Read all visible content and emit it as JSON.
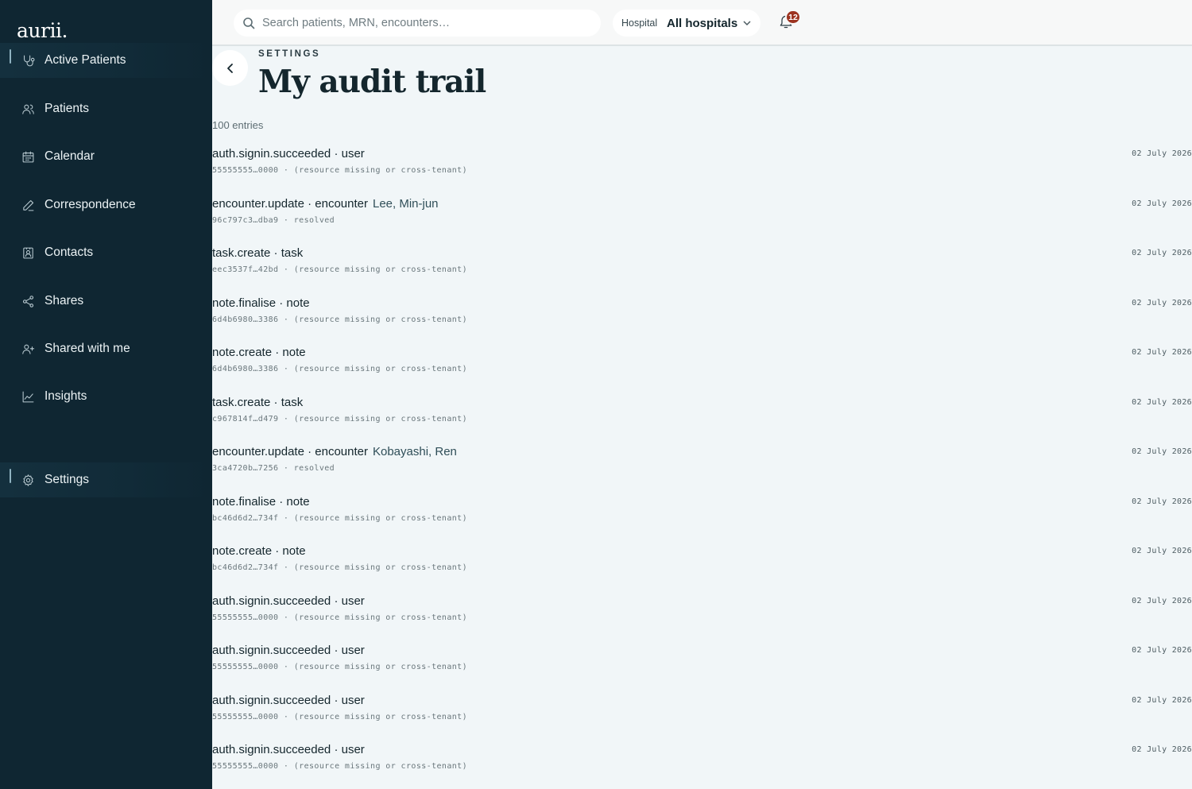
{
  "app": {
    "brand": "aurii."
  },
  "sidebar": {
    "items": [
      {
        "label": "Active Patients",
        "icon": "stethoscope-icon",
        "active": true
      },
      {
        "label": "Patients",
        "icon": "users-icon",
        "active": false
      },
      {
        "label": "Calendar",
        "icon": "calendar-icon",
        "active": false
      },
      {
        "label": "Correspondence",
        "icon": "pen-icon",
        "active": false
      },
      {
        "label": "Contacts",
        "icon": "contact-card-icon",
        "active": false
      },
      {
        "label": "Shares",
        "icon": "share-icon",
        "active": false
      },
      {
        "label": "Shared with me",
        "icon": "user-plus-icon",
        "active": false
      },
      {
        "label": "Insights",
        "icon": "chart-line-icon",
        "active": false
      },
      {
        "label": "Settings",
        "icon": "gear-icon",
        "active": true
      }
    ]
  },
  "topbar": {
    "search": {
      "placeholder": "Search patients, MRN, encounters…",
      "value": ""
    },
    "hospital": {
      "label": "Hospital",
      "value": "All hospitals"
    },
    "notifications": {
      "count": "12"
    }
  },
  "page": {
    "eyebrow": "SETTINGS",
    "title": "My audit trail",
    "entries_count": "100 entries"
  },
  "entries": [
    {
      "action": "auth.signin.succeeded · user",
      "patient": "",
      "meta": "55555555…0000 · (resource missing or cross-tenant)",
      "date": "02 July 2026"
    },
    {
      "action": "encounter.update · encounter",
      "patient": "Lee, Min-jun",
      "meta": "96c797c3…dba9 · resolved",
      "date": "02 July 2026"
    },
    {
      "action": "task.create · task",
      "patient": "",
      "meta": "eec3537f…42bd · (resource missing or cross-tenant)",
      "date": "02 July 2026"
    },
    {
      "action": "note.finalise · note",
      "patient": "",
      "meta": "6d4b6980…3386 · (resource missing or cross-tenant)",
      "date": "02 July 2026"
    },
    {
      "action": "note.create · note",
      "patient": "",
      "meta": "6d4b6980…3386 · (resource missing or cross-tenant)",
      "date": "02 July 2026"
    },
    {
      "action": "task.create · task",
      "patient": "",
      "meta": "c967814f…d479 · (resource missing or cross-tenant)",
      "date": "02 July 2026"
    },
    {
      "action": "encounter.update · encounter",
      "patient": "Kobayashi, Ren",
      "meta": "3ca4720b…7256 · resolved",
      "date": "02 July 2026"
    },
    {
      "action": "note.finalise · note",
      "patient": "",
      "meta": "bc46d6d2…734f · (resource missing or cross-tenant)",
      "date": "02 July 2026"
    },
    {
      "action": "note.create · note",
      "patient": "",
      "meta": "bc46d6d2…734f · (resource missing or cross-tenant)",
      "date": "02 July 2026"
    },
    {
      "action": "auth.signin.succeeded · user",
      "patient": "",
      "meta": "55555555…0000 · (resource missing or cross-tenant)",
      "date": "02 July 2026"
    },
    {
      "action": "auth.signin.succeeded · user",
      "patient": "",
      "meta": "55555555…0000 · (resource missing or cross-tenant)",
      "date": "02 July 2026"
    },
    {
      "action": "auth.signin.succeeded · user",
      "patient": "",
      "meta": "55555555…0000 · (resource missing or cross-tenant)",
      "date": "02 July 2026"
    },
    {
      "action": "auth.signin.succeeded · user",
      "patient": "",
      "meta": "55555555…0000 · (resource missing or cross-tenant)",
      "date": "02 July 2026"
    }
  ]
}
